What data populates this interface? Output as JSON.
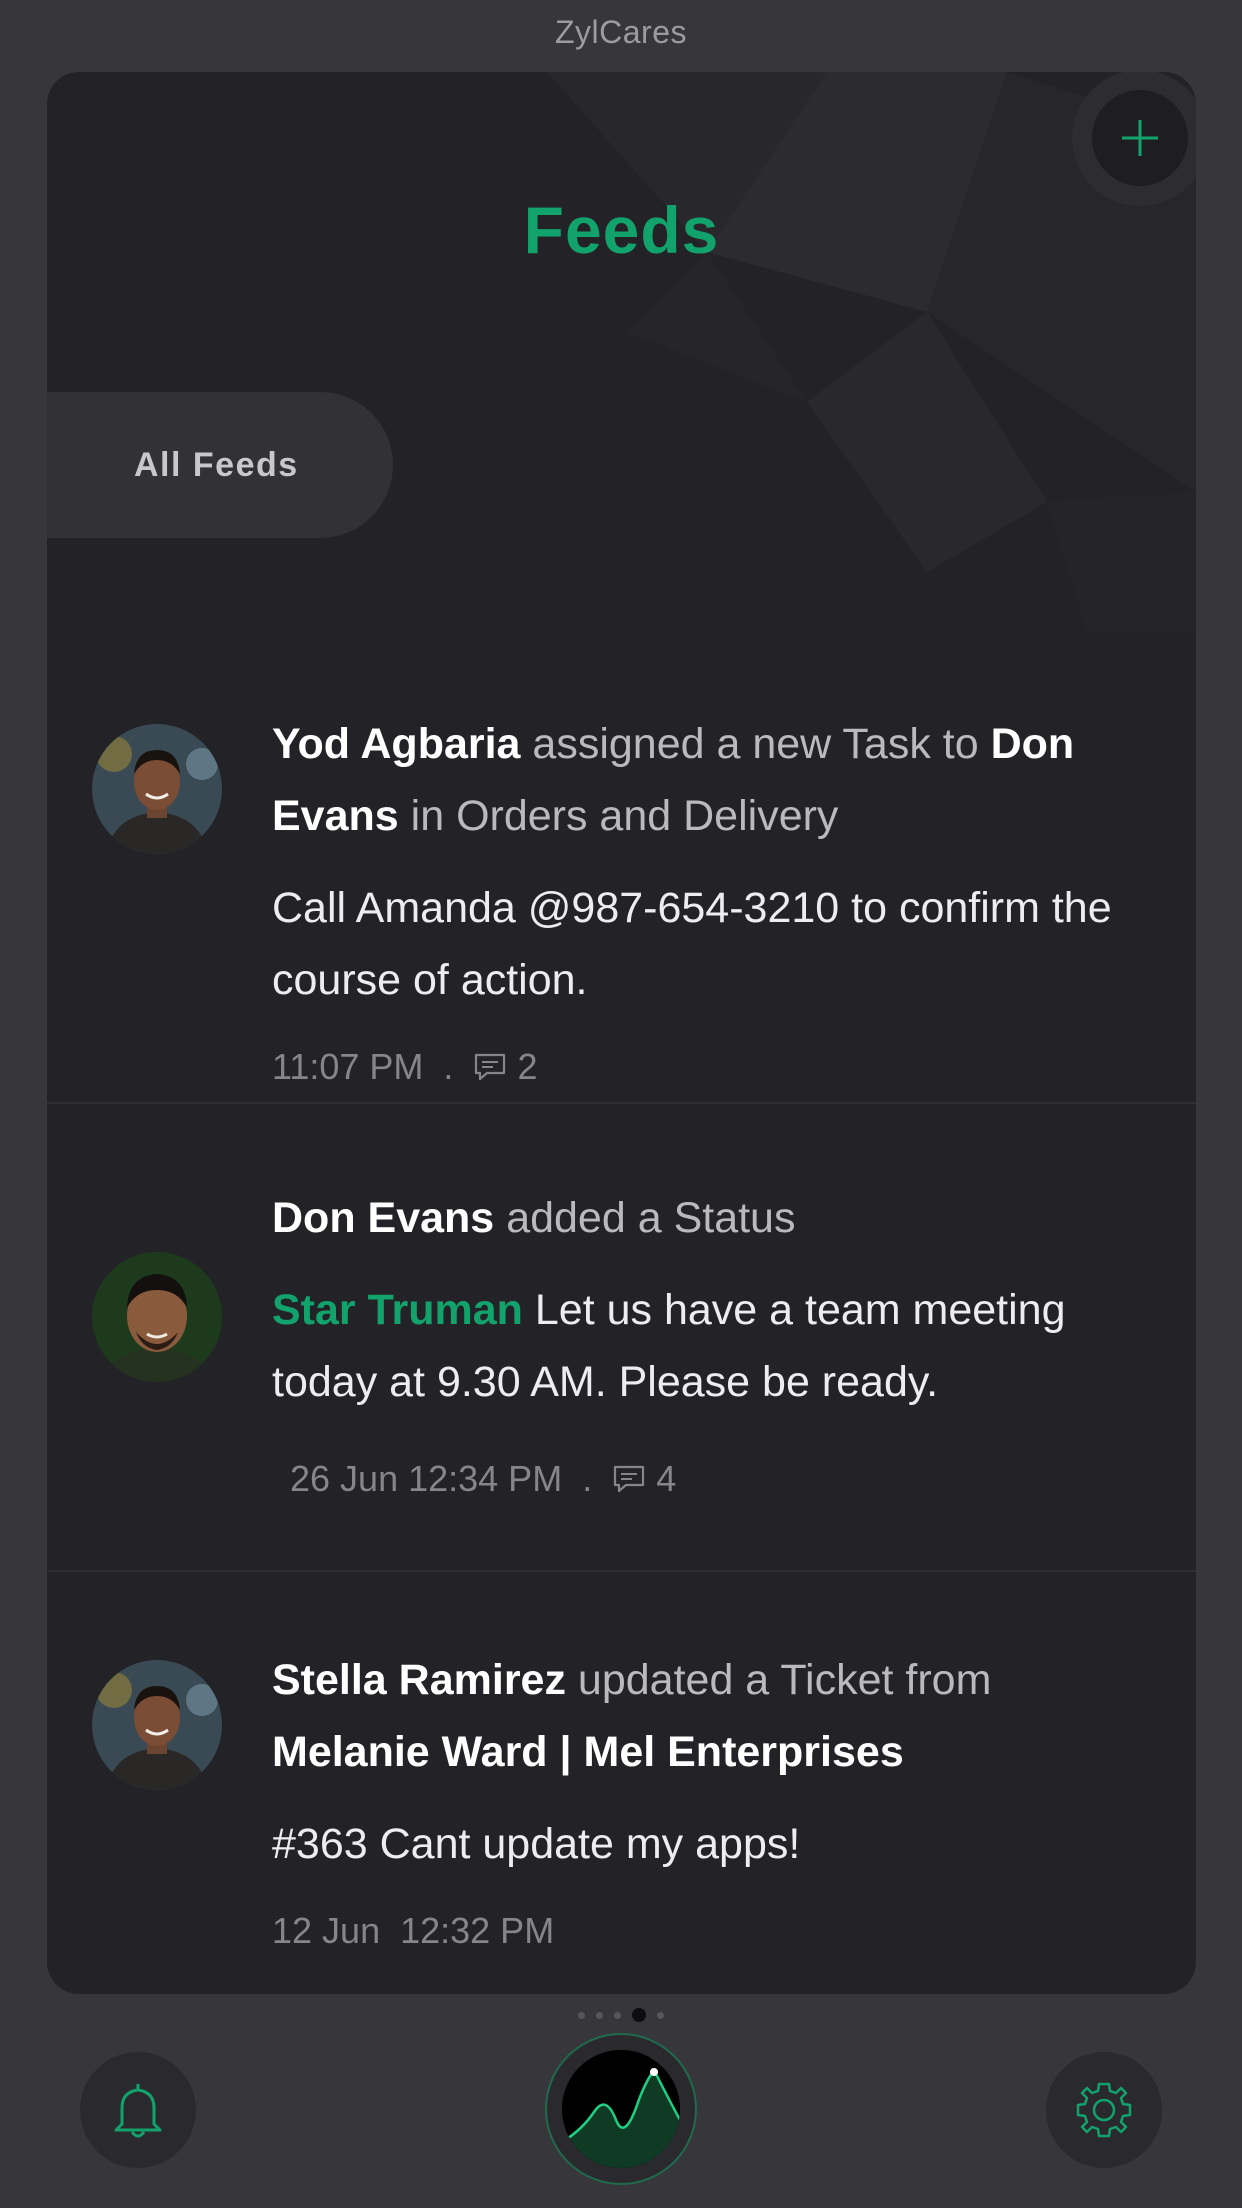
{
  "app": {
    "title": "ZylCares"
  },
  "header": {
    "title": "Feeds",
    "add_icon": "plus-icon"
  },
  "filter": {
    "label": "All Feeds"
  },
  "feeds": [
    {
      "actor": "Yod Agbaria",
      "action": "assigned a new Task to",
      "target": "Don Evans",
      "context": "in Orders and Delivery",
      "message": "Call Amanda @987-654-3210 to confirm the course of action.",
      "time": "11:07 PM",
      "comment_count": "2"
    },
    {
      "actor": "Don Evans",
      "action": "added a Status",
      "mention": "Star Truman",
      "message": "Let us have a team meeting today at 9.30 AM. Please be ready.",
      "time": "26 Jun 12:34 PM",
      "comment_count": "4"
    },
    {
      "actor": "Stella Ramirez",
      "action": "updated a Ticket from",
      "target": "Melanie Ward | Mel Enterprises",
      "message": "#363 Cant update my apps!",
      "time": "12 Jun  12:32 PM"
    }
  ],
  "meta_separator": ".",
  "pager": {
    "total": 5,
    "active": 4
  },
  "bottom_nav": {
    "left_icon": "bell-icon",
    "center_icon": "activity-chart-icon",
    "right_icon": "gear-icon"
  },
  "colors": {
    "accent": "#12a26b",
    "background": "#36363b",
    "card": "#232327",
    "text_primary": "#ffffff",
    "text_secondary": "#b9b9be",
    "text_meta": "#85858a"
  }
}
